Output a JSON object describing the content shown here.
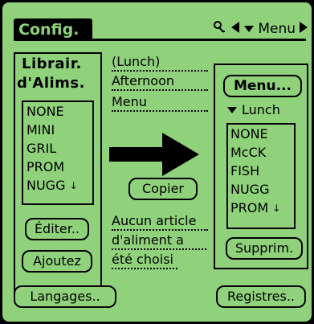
{
  "title": {
    "text": "Config.",
    "icons": [
      "key-icon",
      "left-arrow-icon",
      "chevron-down-icon",
      "right-arrow-icon"
    ],
    "menu_label": "Menu"
  },
  "left": {
    "header_line1": "Librair.",
    "header_line2": "d'Alims.",
    "list": [
      "NONE",
      "MINI",
      "GRIL",
      "PROM",
      "NUGG"
    ],
    "scroll_indicator": "↓",
    "buttons": {
      "edit": "Éditer..",
      "add": "Ajoutez"
    }
  },
  "middle": {
    "lunch": "(Lunch)",
    "afternoon": "Afternoon",
    "menu": "Menu",
    "copy_button": "Copier",
    "no_item_line1": "Aucun article",
    "no_item_line2": "d'aliment a",
    "no_item_line3": "été choisi"
  },
  "right": {
    "menu_button": "Menu...",
    "popup_label": "Lunch",
    "list": [
      "NONE",
      "McCK",
      "FISH",
      "NUGG",
      "PROM"
    ],
    "scroll_indicator": "↓",
    "delete_button": "Supprim."
  },
  "bottom": {
    "languages_button": "Langages..",
    "records_button": "Registres.."
  },
  "colors": {
    "screen_bg": "#8fd27b",
    "foreground": "#000000"
  }
}
